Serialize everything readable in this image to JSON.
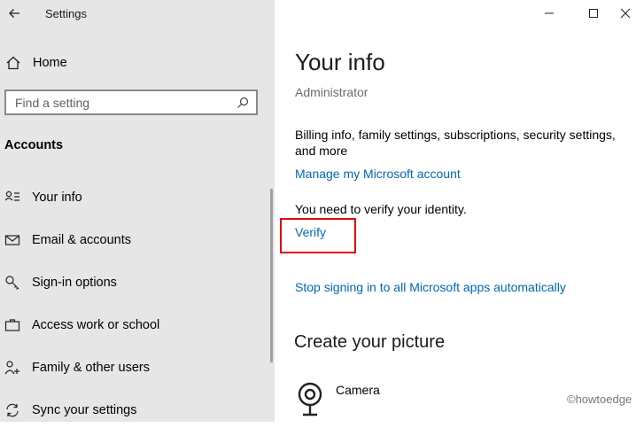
{
  "window": {
    "app_title": "Settings"
  },
  "sidebar": {
    "home_label": "Home",
    "search": {
      "placeholder": "Find a setting"
    },
    "section_heading": "Accounts",
    "items": [
      {
        "label": "Your info",
        "icon": "person-card-icon"
      },
      {
        "label": "Email & accounts",
        "icon": "envelope-icon"
      },
      {
        "label": "Sign-in options",
        "icon": "key-icon"
      },
      {
        "label": "Access work or school",
        "icon": "briefcase-icon"
      },
      {
        "label": "Family & other users",
        "icon": "person-add-icon"
      },
      {
        "label": "Sync your settings",
        "icon": "sync-icon"
      }
    ]
  },
  "main": {
    "title": "Your info",
    "account_type": "Administrator",
    "billing_text": "Billing info, family settings, subscriptions, security settings, and more",
    "manage_link": "Manage my Microsoft account",
    "verify_text": "You need to verify your identity.",
    "verify_link": "Verify",
    "stop_signing_link": "Stop signing in to all Microsoft apps automatically",
    "picture_section_title": "Create your picture",
    "camera_label": "Camera"
  },
  "watermark": "©howtoedge",
  "colors": {
    "link": "#0067b8",
    "highlight": "#e00000",
    "sidebar_bg": "#e6e6e6"
  }
}
